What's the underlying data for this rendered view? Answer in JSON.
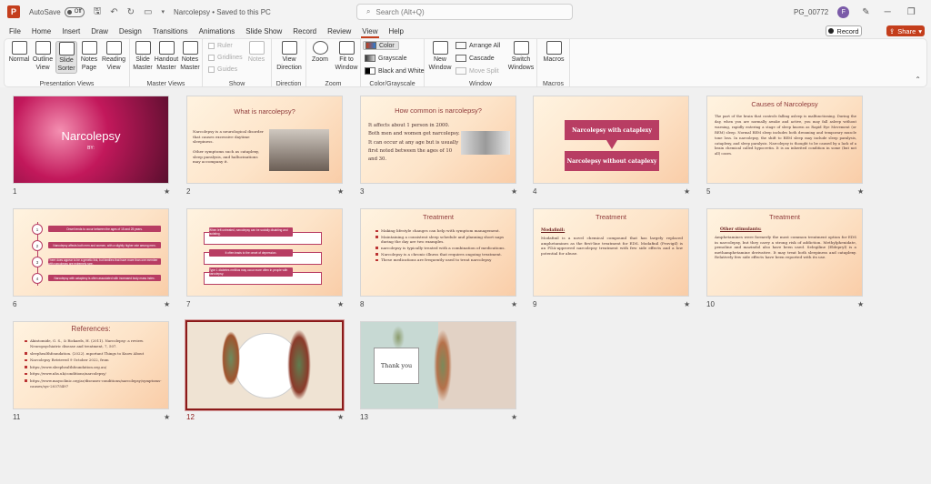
{
  "titlebar": {
    "logo": "P",
    "autosave_label": "AutoSave",
    "autosave_state": "Off",
    "doc_title": "Narcolepsy • Saved to this PC",
    "search_placeholder": "Search (Alt+Q)",
    "user_id": "PG_00772",
    "avatar_letter": "F"
  },
  "menu": {
    "tabs": [
      "File",
      "Home",
      "Insert",
      "Draw",
      "Design",
      "Transitions",
      "Animations",
      "Slide Show",
      "Record",
      "Review",
      "View",
      "Help"
    ],
    "active": "View",
    "record_label": "Record",
    "share_label": "Share"
  },
  "ribbon": {
    "presentation_views": {
      "label": "Presentation Views",
      "items": [
        "Normal",
        "Outline View",
        "Slide Sorter",
        "Notes Page",
        "Reading View"
      ]
    },
    "master_views": {
      "label": "Master Views",
      "items": [
        "Slide Master",
        "Handout Master",
        "Notes Master"
      ]
    },
    "show": {
      "label": "Show",
      "items": [
        "Ruler",
        "Gridlines",
        "Guides"
      ],
      "notes": "Notes"
    },
    "direction": {
      "label": "Direction",
      "item": "View Direction"
    },
    "zoom": {
      "label": "Zoom",
      "items": [
        "Zoom",
        "Fit to Window"
      ]
    },
    "color": {
      "label": "Color/Grayscale",
      "items": [
        "Color",
        "Grayscale",
        "Black and White"
      ]
    },
    "window": {
      "label": "Window",
      "new_window": "New Window",
      "items": [
        "Arrange All",
        "Cascade",
        "Move Split"
      ],
      "switch": "Switch Windows"
    },
    "macros": {
      "label": "Macros",
      "item": "Macros"
    }
  },
  "slides": {
    "s1": {
      "num": "1",
      "title": "Narcolepsy",
      "subtitle": "BY:"
    },
    "s2": {
      "num": "2",
      "title": "What is narcolepsy?",
      "body": "Narcolepsy is a neurological disorder that causes excessive daytime sleepiness.",
      "body2": "Other symptoms such as cataplexy, sleep paralysis, and hallucinations may accompany it."
    },
    "s3": {
      "num": "3",
      "title": "How common is narcolepsy?",
      "lines": [
        "It affects about 1 person in 2000.",
        "Both men and women get narcolepsy.",
        "It can occur at any age but is usually",
        "first noted between the ages of 10",
        "and 30."
      ]
    },
    "s4": {
      "num": "4",
      "box1": "Narcolepsy with cataplexy",
      "box2": "Narcolepsy without cataplexy"
    },
    "s5": {
      "num": "5",
      "title": "Causes of Narcolepsy",
      "body": "The part of the brain that controls falling asleep is malfunctioning. During the day, when you are normally awake and active, you may fall asleep without warning, rapidly entering a stage of sleep known as Rapid Eye Movement (or REM) sleep. Normal REM sleep includes both dreaming and temporary muscle tone loss. In narcolepsy, the shift to REM sleep may include sleep paralysis, cataplexy, and sleep paralysis. Narcolepsy is thought to be caused by a lack of a brain chemical called hypocretin. It is an inherited condition in some (but not all) cases."
    },
    "s6": {
      "num": "6",
      "items": [
        "Onset tends to occur between the ages of 15 and 25 years.",
        "Narcolepsy affects both men and women, with a slightly higher rate among men.",
        "There does appear to be a genetic link, but families that have more than one member with narcolepsy are extremely rare.",
        "Narcolepsy with cataplexy is often associated with increased body mass index."
      ]
    },
    "s7": {
      "num": "7",
      "items": [
        "When left untreated, narcolepsy can be socially disabling and isolating.",
        "It often leads to the onset of depression.",
        "Type 1 diabetes mellitus may occur more often in people with narcolepsy."
      ]
    },
    "s8": {
      "num": "8",
      "title": "Treatment",
      "items": [
        "Making lifestyle changes can help with symptom management.",
        "Maintaining a consistent sleep schedule and planning short naps during the day are two examples.",
        "narcolepsy is typically treated with a combination of medications.",
        "Narcolepsy is a chronic illness that requires ongoing treatment.",
        "These medications are frequently used to treat narcolepsy"
      ]
    },
    "s9": {
      "num": "9",
      "title": "Treatment",
      "heading": "Modafinil:",
      "body": "Modafinil is a novel chemical compound that has largely replaced amphetamines as the first-line treatment for EDS. Modafinil (Provigil) is an FDA-approved narcolepsy treatment with few side effects and a low potential for abuse."
    },
    "s10": {
      "num": "10",
      "title": "Treatment",
      "heading": "Other stimulants:",
      "body": "Amphetamines were formerly the most common treatment option for EDS in narcolepsy, but they carry a strong risk of addiction. Methylphenidate, pemoline and mazindol also have been used. Selegiline (Eldepryl) is a methamphetamine derivative. It may treat both sleepiness and cataplexy. Relatively few side effects have been reported with its use."
    },
    "s11": {
      "num": "11",
      "title": "References:",
      "items": [
        "Akintomide, G. S., & Rickards, H. (2011). Narcolepsy: a review. Neuropsychiatric disease and treatment, 7, 507.",
        "sleephealthfoundation. (2022). mportant Things to Know About",
        "Narcolepsy Retrieved 9 October 2022, from",
        "https://www.sleephealthfoundation.org.au/",
        "https://www.nhs.uk/conditions/narcolepsy/",
        "https://www.mayoclinic.org/ar/diseases-conditions/narcolepsy/symptoms-causes/syc-20375497"
      ]
    },
    "s12": {
      "num": "12"
    },
    "s13": {
      "num": "13",
      "text": "Thank you"
    }
  },
  "star": "★",
  "colors": {
    "accent": "#c43e1c",
    "selected": "#8b1a1a",
    "box": "#b83d63"
  }
}
